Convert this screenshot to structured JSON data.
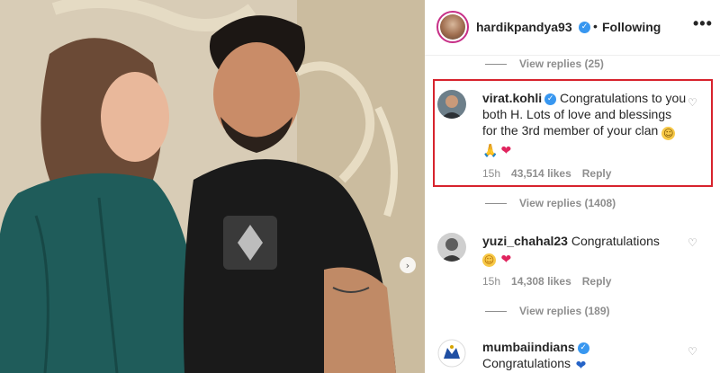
{
  "post": {
    "username": "hardikpandya93",
    "verified": true,
    "separator": "•",
    "follow_status": "Following",
    "more_label": "•••",
    "carousel_next_glyph": "›"
  },
  "comments": [
    {
      "view_replies": "View replies (25)"
    },
    {
      "username": "virat.kohli",
      "verified": true,
      "text": "Congratulations to you both H. Lots of love and blessings for the 3rd member of your clan",
      "emojis": [
        "smile",
        "pray",
        "heart-red"
      ],
      "time": "15h",
      "likes": "43,514 likes",
      "reply_label": "Reply",
      "view_replies": "View replies (1408)",
      "highlighted": true
    },
    {
      "username": "yuzi_chahal23",
      "verified": false,
      "text": "Congratulations",
      "emojis": [
        "blush",
        "heart-red"
      ],
      "time": "15h",
      "likes": "14,308 likes",
      "reply_label": "Reply",
      "view_replies": "View replies (189)"
    },
    {
      "username": "mumbaiindians",
      "verified": true,
      "text": "Congratulations",
      "emojis": [
        "heart-blue"
      ]
    }
  ],
  "glyphs": {
    "verified": "✓",
    "heart_outline": "♡",
    "smile": "☺",
    "pray": "🙏",
    "heart": "❤"
  },
  "colors": {
    "accent_blue": "#3897f0",
    "highlight_red": "#d7232d",
    "meta_gray": "#8e8e8e",
    "text": "#262626"
  }
}
